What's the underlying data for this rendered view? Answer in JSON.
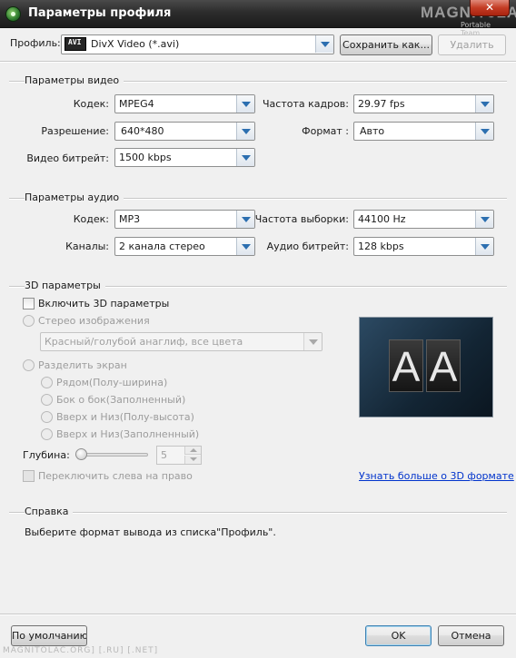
{
  "window": {
    "title": "Параметры профиля",
    "brand": "MAGNIT0LA",
    "brand_sub": "Portable Team",
    "close_glyph": "✕"
  },
  "profile": {
    "label": "Профиль:",
    "value": "DivX Video (*.avi)",
    "icon_text": "AVI",
    "save_label": "Сохранить как...",
    "delete_label": "Удалить"
  },
  "video": {
    "group_title": "Параметры видео",
    "codec_label": "Кодек:",
    "codec_value": "MPEG4",
    "resolution_label": "Разрешение:",
    "resolution_value": "640*480",
    "bitrate_label": "Видео битрейт:",
    "bitrate_value": "1500 kbps",
    "framerate_label": "Частота кадров:",
    "framerate_value": "29.97 fps",
    "format_label": "Формат :",
    "format_value": "Авто"
  },
  "audio": {
    "group_title": "Параметры аудио",
    "codec_label": "Кодек:",
    "codec_value": "MP3",
    "channels_label": "Каналы:",
    "channels_value": "2 канала стерео",
    "samplerate_label": "Частота выборки:",
    "samplerate_value": "44100 Hz",
    "bitrate_label": "Аудио битрейт:",
    "bitrate_value": "128 kbps"
  },
  "threed": {
    "group_title": "3D параметры",
    "enable_label": "Включить 3D параметры",
    "stereo_label": "Стерео изображения",
    "anaglyph_value": "Красный/голубой анаглиф, все цвета",
    "split_label": "Разделить экран",
    "split_options": [
      "Рядом(Полу-ширина)",
      "Бок о бок(Заполненный)",
      "Вверх и Низ(Полу-высота)",
      "Вверх и Низ(Заполненный)"
    ],
    "depth_label": "Глубина:",
    "depth_value": "5",
    "swap_label": "Переключить слева на право",
    "learn_more": "Узнать больше о 3D формате",
    "preview_letters": [
      "A",
      "A"
    ]
  },
  "help": {
    "group_title": "Справка",
    "text": "Выберите формат вывода из списка\"Профиль\"."
  },
  "footer": {
    "default_label": "По умолчанию",
    "ok_label": "OK",
    "cancel_label": "Отмена",
    "watermark": "MAGNITOLAC.ORG] [.RU] [.NET]"
  }
}
